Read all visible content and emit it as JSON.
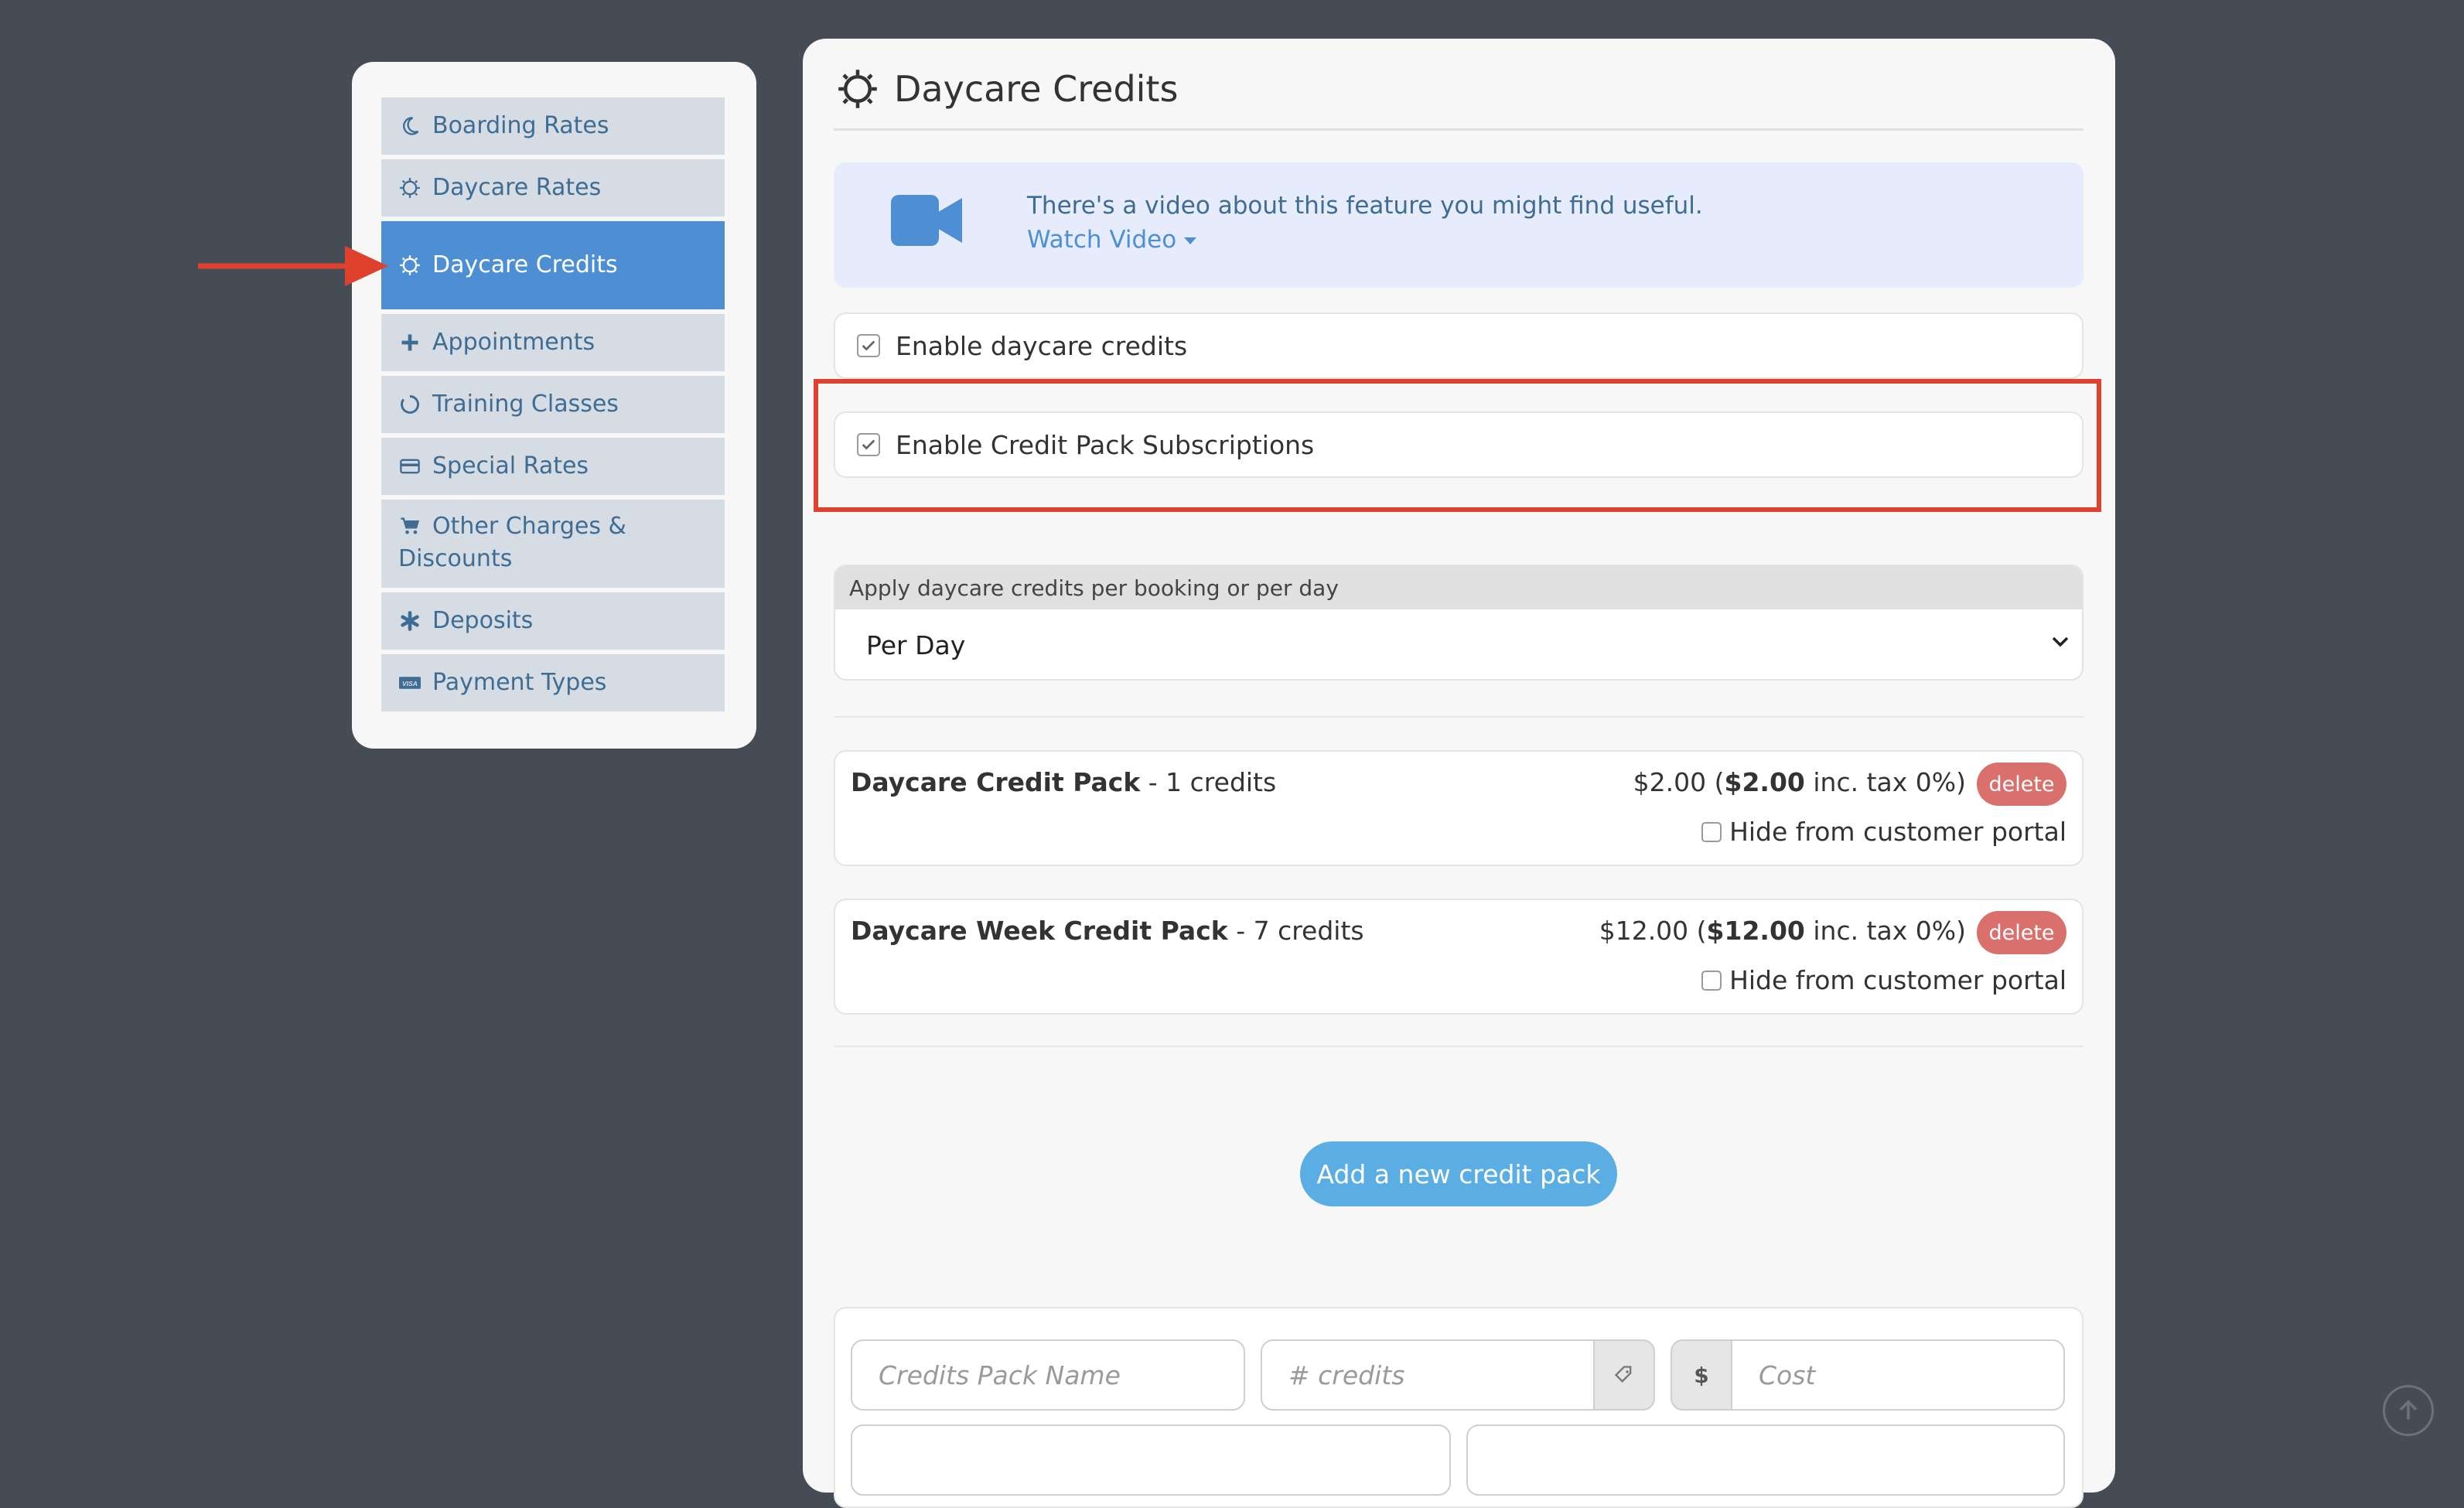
{
  "sidebar": {
    "items": [
      {
        "label": "Boarding Rates",
        "icon": "moon-icon"
      },
      {
        "label": "Daycare Rates",
        "icon": "sun-icon"
      },
      {
        "label": "Daycare Credits",
        "icon": "sun-icon",
        "active": true
      },
      {
        "label": "Appointments",
        "icon": "plus-icon"
      },
      {
        "label": "Training Classes",
        "icon": "circle-notch-icon"
      },
      {
        "label": "Special Rates",
        "icon": "credit-card-icon"
      },
      {
        "label": "Other Charges & Discounts",
        "icon": "cart-icon"
      },
      {
        "label": "Deposits",
        "icon": "asterisk-icon"
      },
      {
        "label": "Payment Types",
        "icon": "visa-icon"
      }
    ]
  },
  "main": {
    "title": "Daycare Credits",
    "video": {
      "text": "There's a video about this feature you might find useful.",
      "link": "Watch Video"
    },
    "enable_credits": {
      "label": "Enable daycare credits",
      "checked": true
    },
    "enable_subscriptions": {
      "label": "Enable Credit Pack Subscriptions",
      "checked": true
    },
    "apply_select": {
      "label": "Apply daycare credits per booking or per day",
      "value": "Per Day"
    },
    "packs": [
      {
        "name": "Daycare Credit Pack",
        "credits": " - 1 credits",
        "price_open": "$2.00 (",
        "price_bold": "$2.00",
        "price_close": " inc. tax 0%)",
        "delete": "delete",
        "hide": "Hide from customer portal"
      },
      {
        "name": "Daycare Week Credit Pack",
        "credits": " - 7 credits",
        "price_open": "$12.00 (",
        "price_bold": "$12.00",
        "price_close": " inc. tax 0%)",
        "delete": "delete",
        "hide": "Hide from customer portal"
      }
    ],
    "add_button": "Add a new credit pack",
    "new_form": {
      "name_placeholder": "Credits Pack Name",
      "credits_placeholder": "# credits",
      "currency": "$",
      "cost_placeholder": "Cost"
    }
  },
  "colors": {
    "background": "#464c55",
    "active": "#4e8fd3",
    "accent_link": "#4e8fd3",
    "delete": "#d9706b",
    "add_button": "#5aaee3",
    "highlight": "#e0412f"
  }
}
